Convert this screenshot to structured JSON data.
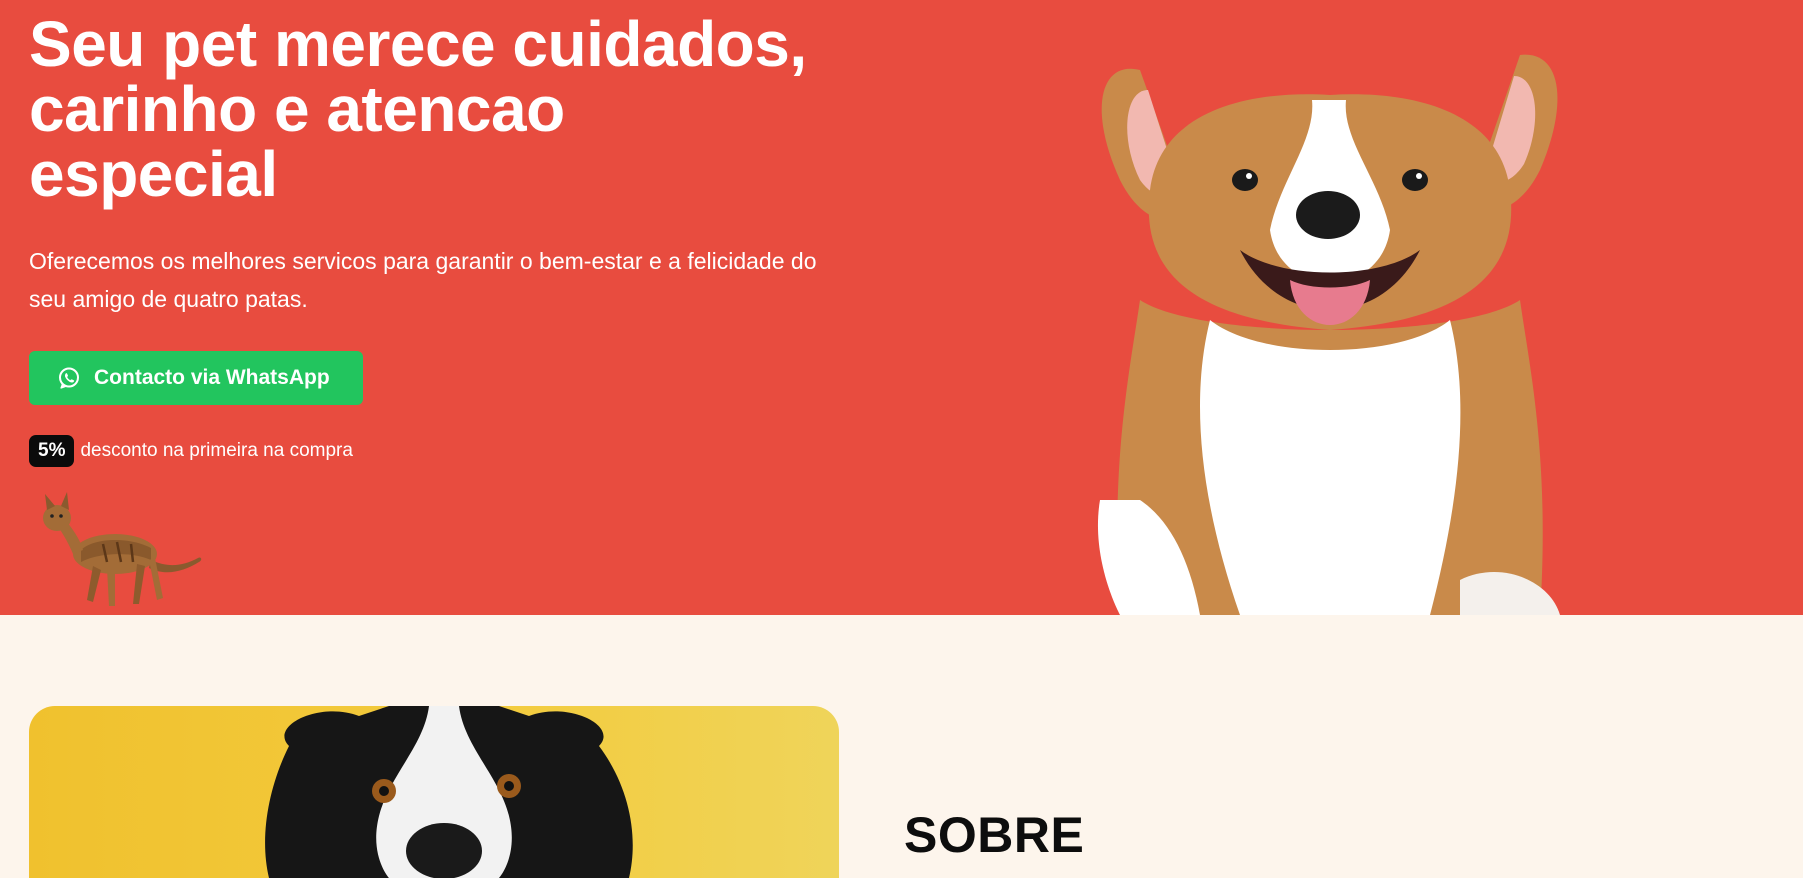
{
  "hero": {
    "title_lines": [
      "Seu pet merece cuidados,",
      "carinho e atencao",
      "especial"
    ],
    "subtitle": "Oferecemos os melhores servicos para garantir o bem-estar e a felicidade do seu amigo de quatro patas.",
    "cta_label": "Contacto via WhatsApp",
    "discount_badge": "5%",
    "discount_text": "desconto na primeira na compra"
  },
  "about": {
    "title": "SOBRE"
  },
  "icons": {
    "cta_icon": "whatsapp-icon"
  },
  "colors": {
    "hero_background": "#e84c3f",
    "cta_background": "#22c55e",
    "page_background": "#fdf5ec",
    "about_image_background": "#f0c12e"
  }
}
